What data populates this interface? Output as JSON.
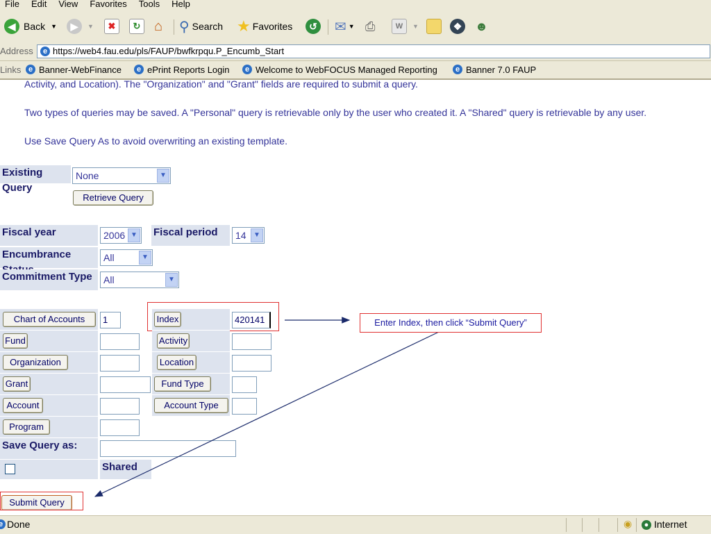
{
  "menu": [
    "File",
    "Edit",
    "View",
    "Favorites",
    "Tools",
    "Help"
  ],
  "toolbar": {
    "back_label": "Back",
    "search_label": "Search",
    "favorites_label": "Favorites"
  },
  "address": {
    "label": "Address",
    "url": "https://web4.fau.edu/pls/FAUP/bwfkrpqu.P_Encumb_Start"
  },
  "links": {
    "label": "Links",
    "items": [
      "Banner-WebFinance",
      "ePrint Reports Login",
      "Welcome to WebFOCUS Managed Reporting",
      "Banner 7.0 FAUP"
    ]
  },
  "page": {
    "intro_partial": "Activity, and Location). The \"Organization\" and \"Grant\" fields are required to submit a query.",
    "para_saved": "Two types of queries may be saved. A \"Personal\" query is retrievable only by the user who created it. A \"Shared\" query is retrievable by any user.",
    "para_saveas": "Use Save Query As to avoid overwriting an existing template.",
    "existing_query_label": "Existing Query",
    "existing_query_value": "None",
    "retrieve_button": "Retrieve Query",
    "fiscal_year_label": "Fiscal year",
    "fiscal_year_value": "2006",
    "fiscal_period_label": "Fiscal period",
    "fiscal_period_value": "14",
    "encumbrance_status_label": "Encumbrance Status",
    "encumbrance_status_value": "All",
    "commitment_type_label": "Commitment Type",
    "commitment_type_value": "All",
    "chart_of_accounts_button": "Chart of Accounts",
    "chart_of_accounts_value": "1",
    "index_button": "Index",
    "index_value": "420141",
    "fund_button": "Fund",
    "activity_button": "Activity",
    "organization_button": "Organization",
    "location_button": "Location",
    "grant_button": "Grant",
    "fund_type_button": "Fund Type",
    "account_button": "Account",
    "account_type_button": "Account Type",
    "program_button": "Program",
    "save_query_label": "Save Query as:",
    "shared_label": "Shared",
    "submit_button": "Submit Query"
  },
  "annotation": {
    "callout_text": "Enter Index, then click “Submit Query”"
  },
  "status": {
    "text": "Done",
    "zone": "Internet"
  }
}
